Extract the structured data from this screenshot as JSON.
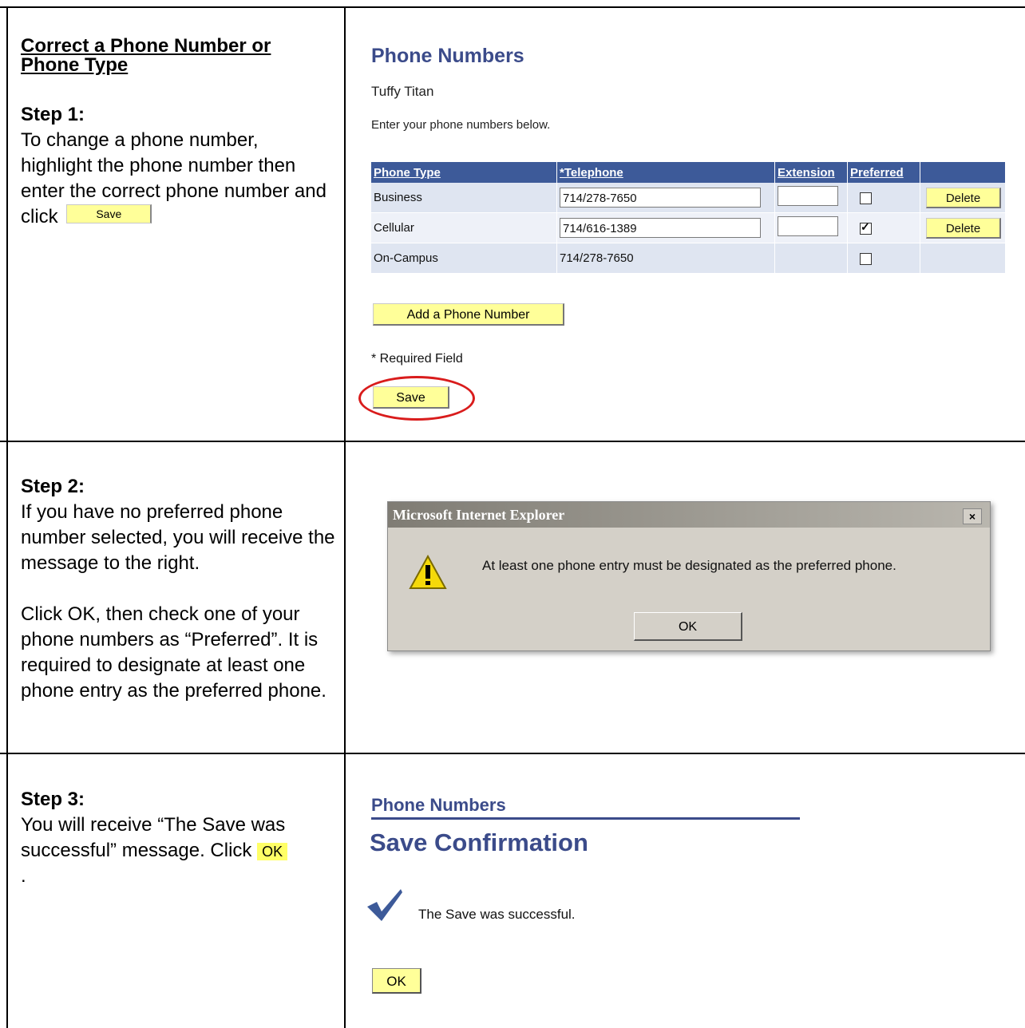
{
  "section1": {
    "heading": "Correct a Phone Number or Phone Type",
    "step_title": "Step 1:",
    "instruction": "To change a phone number, highlight the phone number then enter the correct phone number and click",
    "inline_save_label": "Save",
    "page_title": "Phone Numbers",
    "person_name": "Tuffy Titan",
    "page_instruction": "Enter your phone numbers below.",
    "columns": [
      "Phone Type",
      "*Telephone",
      "Extension",
      "Preferred",
      ""
    ],
    "rows": [
      {
        "type": "Business",
        "telephone": "714/278-7650",
        "extension": "",
        "preferred": false,
        "delete_label": "Delete"
      },
      {
        "type": "Cellular",
        "telephone": "714/616-1389",
        "extension": "",
        "preferred": true,
        "delete_label": "Delete"
      },
      {
        "type": "On-Campus",
        "telephone": "714/278-7650",
        "extension": "",
        "preferred": false,
        "delete_label": ""
      }
    ],
    "add_button": "Add a Phone Number",
    "required_note": "* Required Field",
    "save_label": "Save"
  },
  "section2": {
    "step_title": "Step 2:",
    "para1": "If you have no preferred phone number selected, you will receive the message to the right.",
    "para2": "Click OK, then check one of your phone numbers as “Preferred”. It is required to designate at least one phone entry as the preferred phone.",
    "dialog_title": "Microsoft Internet Explorer",
    "dialog_close": "×",
    "dialog_message": "At least  one phone entry must be designated as the preferred phone.",
    "dialog_ok": "OK"
  },
  "section3": {
    "step_title": "Step 3:",
    "instruction": "You will receive “The Save was successful” message.  Click",
    "inline_ok": "OK",
    "period": ".",
    "page_title": "Phone Numbers",
    "confirm_title": "Save Confirmation",
    "message": "The Save was successful.",
    "ok_label": "OK"
  },
  "colors": {
    "ps_blue": "#3b4b8a",
    "button_yellow": "#ffff99",
    "highlight_red": "#d91c1c"
  }
}
